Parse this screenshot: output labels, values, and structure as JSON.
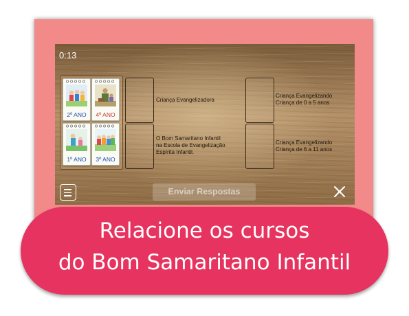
{
  "game": {
    "timer": "0:13",
    "cards": [
      {
        "label": "2º ANO",
        "label_color": "#1f4fa8"
      },
      {
        "label": "4º ANO",
        "label_color": "#c0392b"
      },
      {
        "label": "1º ANO",
        "label_color": "#1f4fa8"
      },
      {
        "label": "3º ANO",
        "label_color": "#1f4fa8"
      }
    ],
    "pairs": [
      {
        "lines": [
          "Criança Evangelizadora"
        ]
      },
      {
        "lines": [
          "Criança Evangelizando",
          "Criança de 0 a 5 anos"
        ]
      },
      {
        "lines": [
          "O Bom Samaritano Infantil",
          "na Escola de Evangelização",
          "Espírita Infantil."
        ]
      },
      {
        "lines": [
          "Criança Evangelizando",
          "Criança de 6 a 11 anos"
        ]
      }
    ],
    "submit_label": "Enviar Respostas",
    "menu_icon": "hamburger-menu-icon",
    "close_icon": "close-icon"
  },
  "banner": {
    "line1": "Relacione os cursos",
    "line2": "do Bom Samaritano Infantil"
  },
  "colors": {
    "frame": "#f28a8a",
    "banner": "#e6335f"
  }
}
